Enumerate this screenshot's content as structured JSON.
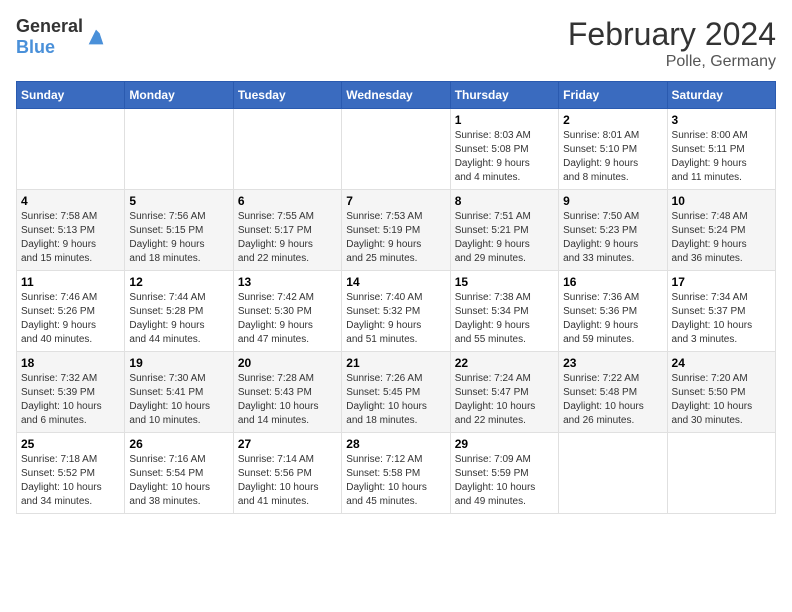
{
  "header": {
    "logo_general": "General",
    "logo_blue": "Blue",
    "title": "February 2024",
    "subtitle": "Polle, Germany"
  },
  "calendar": {
    "days_of_week": [
      "Sunday",
      "Monday",
      "Tuesday",
      "Wednesday",
      "Thursday",
      "Friday",
      "Saturday"
    ],
    "weeks": [
      [
        {
          "day": "",
          "info": ""
        },
        {
          "day": "",
          "info": ""
        },
        {
          "day": "",
          "info": ""
        },
        {
          "day": "",
          "info": ""
        },
        {
          "day": "1",
          "info": "Sunrise: 8:03 AM\nSunset: 5:08 PM\nDaylight: 9 hours\nand 4 minutes."
        },
        {
          "day": "2",
          "info": "Sunrise: 8:01 AM\nSunset: 5:10 PM\nDaylight: 9 hours\nand 8 minutes."
        },
        {
          "day": "3",
          "info": "Sunrise: 8:00 AM\nSunset: 5:11 PM\nDaylight: 9 hours\nand 11 minutes."
        }
      ],
      [
        {
          "day": "4",
          "info": "Sunrise: 7:58 AM\nSunset: 5:13 PM\nDaylight: 9 hours\nand 15 minutes."
        },
        {
          "day": "5",
          "info": "Sunrise: 7:56 AM\nSunset: 5:15 PM\nDaylight: 9 hours\nand 18 minutes."
        },
        {
          "day": "6",
          "info": "Sunrise: 7:55 AM\nSunset: 5:17 PM\nDaylight: 9 hours\nand 22 minutes."
        },
        {
          "day": "7",
          "info": "Sunrise: 7:53 AM\nSunset: 5:19 PM\nDaylight: 9 hours\nand 25 minutes."
        },
        {
          "day": "8",
          "info": "Sunrise: 7:51 AM\nSunset: 5:21 PM\nDaylight: 9 hours\nand 29 minutes."
        },
        {
          "day": "9",
          "info": "Sunrise: 7:50 AM\nSunset: 5:23 PM\nDaylight: 9 hours\nand 33 minutes."
        },
        {
          "day": "10",
          "info": "Sunrise: 7:48 AM\nSunset: 5:24 PM\nDaylight: 9 hours\nand 36 minutes."
        }
      ],
      [
        {
          "day": "11",
          "info": "Sunrise: 7:46 AM\nSunset: 5:26 PM\nDaylight: 9 hours\nand 40 minutes."
        },
        {
          "day": "12",
          "info": "Sunrise: 7:44 AM\nSunset: 5:28 PM\nDaylight: 9 hours\nand 44 minutes."
        },
        {
          "day": "13",
          "info": "Sunrise: 7:42 AM\nSunset: 5:30 PM\nDaylight: 9 hours\nand 47 minutes."
        },
        {
          "day": "14",
          "info": "Sunrise: 7:40 AM\nSunset: 5:32 PM\nDaylight: 9 hours\nand 51 minutes."
        },
        {
          "day": "15",
          "info": "Sunrise: 7:38 AM\nSunset: 5:34 PM\nDaylight: 9 hours\nand 55 minutes."
        },
        {
          "day": "16",
          "info": "Sunrise: 7:36 AM\nSunset: 5:36 PM\nDaylight: 9 hours\nand 59 minutes."
        },
        {
          "day": "17",
          "info": "Sunrise: 7:34 AM\nSunset: 5:37 PM\nDaylight: 10 hours\nand 3 minutes."
        }
      ],
      [
        {
          "day": "18",
          "info": "Sunrise: 7:32 AM\nSunset: 5:39 PM\nDaylight: 10 hours\nand 6 minutes."
        },
        {
          "day": "19",
          "info": "Sunrise: 7:30 AM\nSunset: 5:41 PM\nDaylight: 10 hours\nand 10 minutes."
        },
        {
          "day": "20",
          "info": "Sunrise: 7:28 AM\nSunset: 5:43 PM\nDaylight: 10 hours\nand 14 minutes."
        },
        {
          "day": "21",
          "info": "Sunrise: 7:26 AM\nSunset: 5:45 PM\nDaylight: 10 hours\nand 18 minutes."
        },
        {
          "day": "22",
          "info": "Sunrise: 7:24 AM\nSunset: 5:47 PM\nDaylight: 10 hours\nand 22 minutes."
        },
        {
          "day": "23",
          "info": "Sunrise: 7:22 AM\nSunset: 5:48 PM\nDaylight: 10 hours\nand 26 minutes."
        },
        {
          "day": "24",
          "info": "Sunrise: 7:20 AM\nSunset: 5:50 PM\nDaylight: 10 hours\nand 30 minutes."
        }
      ],
      [
        {
          "day": "25",
          "info": "Sunrise: 7:18 AM\nSunset: 5:52 PM\nDaylight: 10 hours\nand 34 minutes."
        },
        {
          "day": "26",
          "info": "Sunrise: 7:16 AM\nSunset: 5:54 PM\nDaylight: 10 hours\nand 38 minutes."
        },
        {
          "day": "27",
          "info": "Sunrise: 7:14 AM\nSunset: 5:56 PM\nDaylight: 10 hours\nand 41 minutes."
        },
        {
          "day": "28",
          "info": "Sunrise: 7:12 AM\nSunset: 5:58 PM\nDaylight: 10 hours\nand 45 minutes."
        },
        {
          "day": "29",
          "info": "Sunrise: 7:09 AM\nSunset: 5:59 PM\nDaylight: 10 hours\nand 49 minutes."
        },
        {
          "day": "",
          "info": ""
        },
        {
          "day": "",
          "info": ""
        }
      ]
    ]
  }
}
